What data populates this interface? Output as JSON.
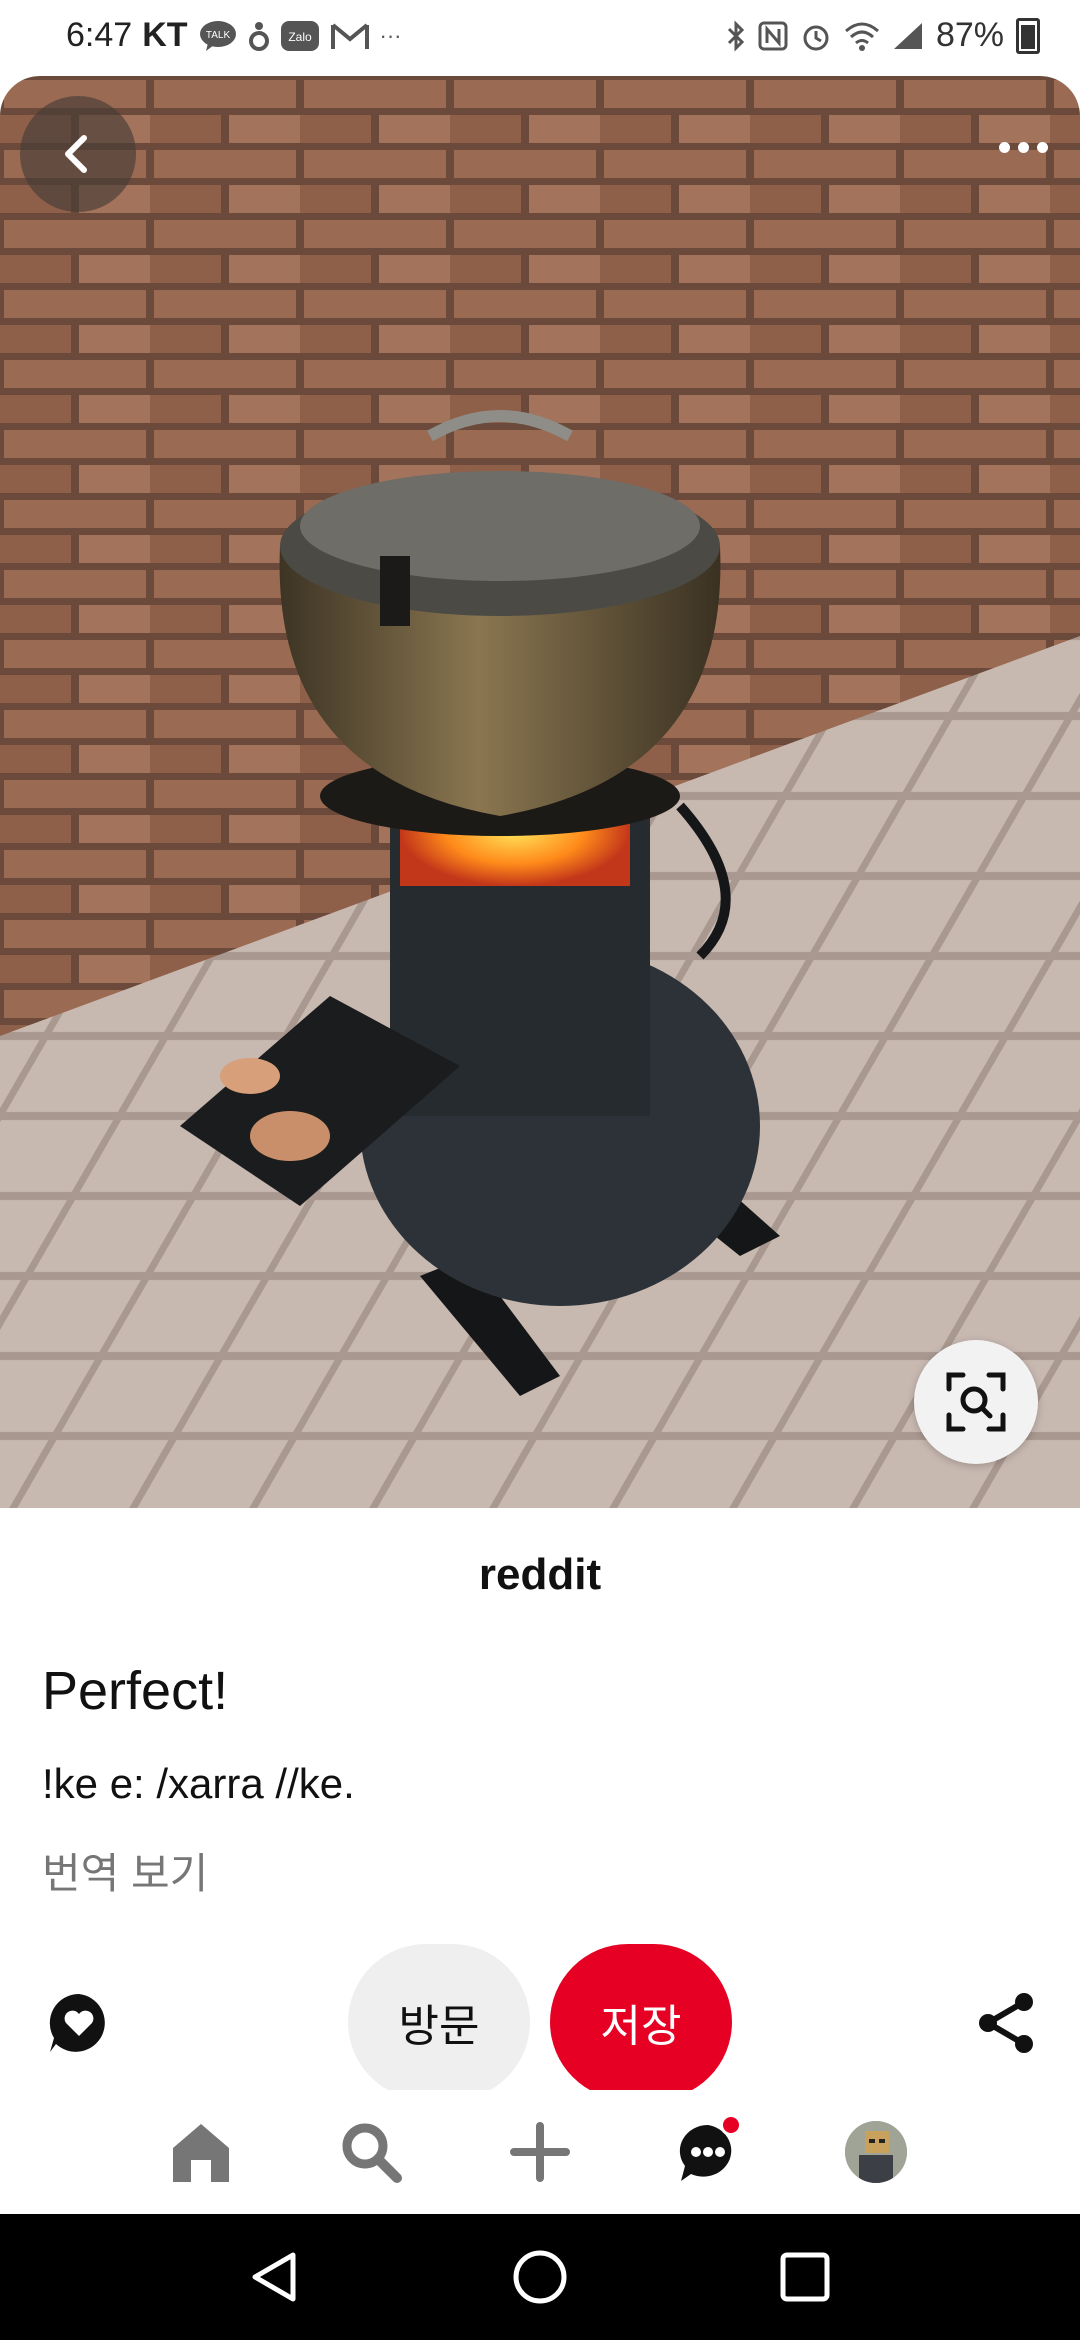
{
  "status_bar": {
    "time": "6:47",
    "carrier": "KT",
    "talk_badge": "TALK",
    "zalo_badge": "Zalo",
    "more_indicator": "···",
    "battery": "87%"
  },
  "pin": {
    "source": "reddit",
    "title": "Perfect!",
    "description": "!ke e: /xarra //ke.",
    "translate_label": "번역 보기"
  },
  "actions": {
    "visit_label": "방문",
    "save_label": "저장"
  },
  "colors": {
    "brand_red": "#e60023",
    "visit_bg": "#efefef"
  },
  "icons": {
    "back": "chevron-left-icon",
    "more": "more-dots-icon",
    "lens": "visual-search-icon",
    "react": "heart-bubble-icon",
    "share": "share-icon",
    "home": "home-icon",
    "search": "search-icon",
    "create": "plus-icon",
    "messages": "chat-icon",
    "profile": "avatar"
  }
}
